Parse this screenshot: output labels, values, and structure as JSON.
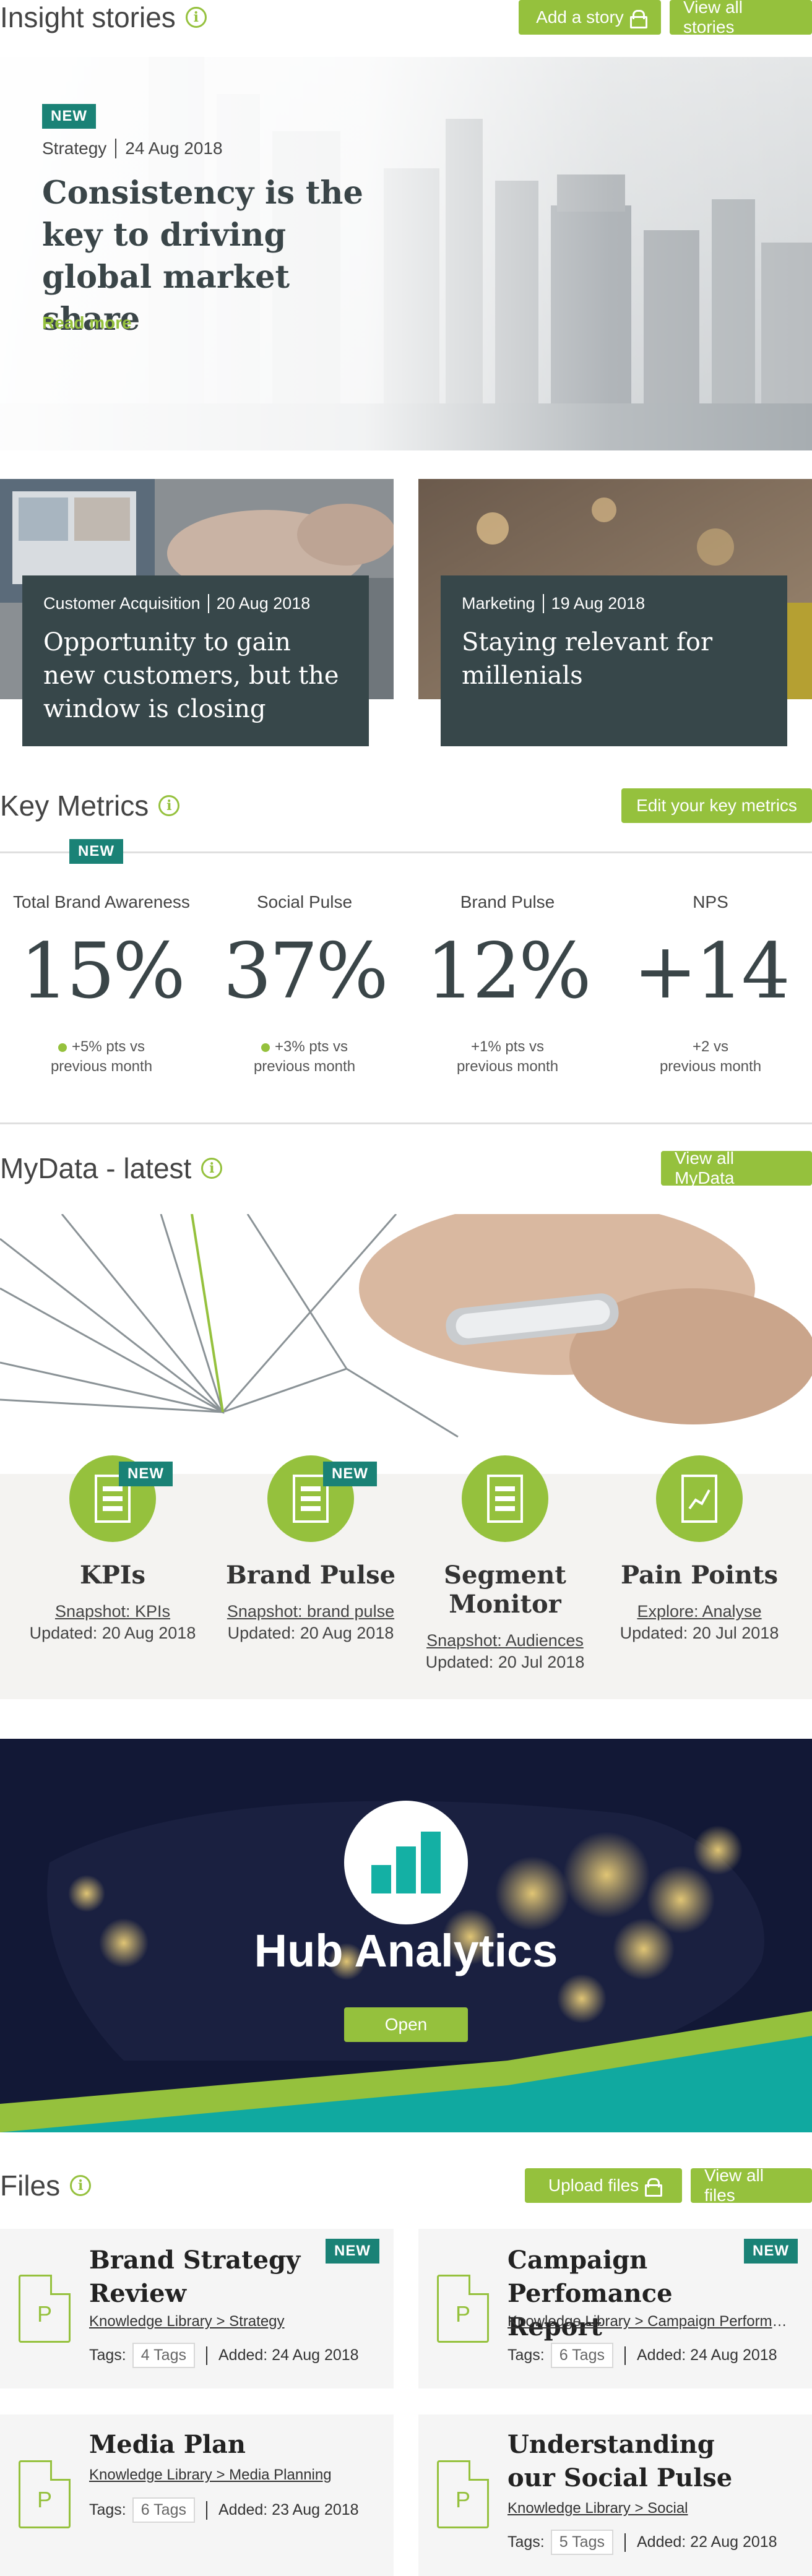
{
  "insight": {
    "title": "Insight stories",
    "add_story_label": "Add a story",
    "view_all_label": "View all stories",
    "hero": {
      "badge": "NEW",
      "category": "Strategy",
      "date": "24 Aug 2018",
      "headline": "Consistency is the key to driving global market share",
      "read_more": "Read more"
    },
    "cards": [
      {
        "category": "Customer Acquisition",
        "date": "20 Aug 2018",
        "headline": "Opportunity to gain new customers, but the window is closing"
      },
      {
        "category": "Marketing",
        "date": "19 Aug 2018",
        "headline": "Staying relevant for millenials"
      }
    ]
  },
  "metrics": {
    "title": "Key Metrics",
    "edit_label": "Edit your key metrics",
    "badge": "NEW",
    "items": [
      {
        "label": "Total Brand Awareness",
        "value": "15%",
        "delta_line1": "+5% pts vs",
        "delta_line2": "previous month"
      },
      {
        "label": "Social Pulse",
        "value": "37%",
        "delta_line1": "+3% pts vs",
        "delta_line2": "previous month"
      },
      {
        "label": "Brand Pulse",
        "value": "12%",
        "delta_line1": "+1% pts vs",
        "delta_line2": "previous month"
      },
      {
        "label": "NPS",
        "value": "+14",
        "delta_line1": "+2 vs",
        "delta_line2": "previous month"
      }
    ]
  },
  "mydata": {
    "title": "MyData - latest",
    "view_all_label": "View all MyData",
    "badge": "NEW",
    "tiles": [
      {
        "name": "KPIs",
        "link": "Snapshot: KPIs",
        "updated": "Updated: 20 Aug 2018"
      },
      {
        "name": "Brand Pulse",
        "link": "Snapshot: brand pulse",
        "updated": "Updated: 20 Aug 2018"
      },
      {
        "name": "Segment Monitor",
        "link": "Snapshot: Audiences",
        "updated": "Updated: 20 Jul 2018"
      },
      {
        "name": "Pain Points",
        "link": "Explore: Analyse",
        "updated": "Updated: 20 Jul 2018"
      }
    ]
  },
  "hub": {
    "title": "Hub Analytics",
    "open_label": "Open"
  },
  "files": {
    "title": "Files",
    "upload_label": "Upload files",
    "view_all_label": "View all files",
    "badge": "NEW",
    "tags_label": "Tags:",
    "items": [
      {
        "title": "Brand Strategy Review",
        "path": "Knowledge Library > Strategy",
        "tags": "4 Tags",
        "added": "Added: 24 Aug 2018",
        "icon_letter": "P"
      },
      {
        "title": "Campaign Perfomance Report",
        "path": "Knowledge Library > Campaign Performance",
        "tags": "6 Tags",
        "added": "Added: 24 Aug 2018",
        "icon_letter": "P"
      },
      {
        "title": "Media Plan",
        "path": "Knowledge Library > Media Planning",
        "tags": "6 Tags",
        "added": "Added: 23 Aug 2018",
        "icon_letter": "P"
      },
      {
        "title": "Understanding our Social Pulse",
        "path": "Knowledge Library > Social",
        "tags": "5 Tags",
        "added": "Added: 22 Aug 2018",
        "icon_letter": "P"
      }
    ]
  },
  "colors": {
    "accent": "#95c13d",
    "teal": "#1a8276",
    "dark_card": "#37474a"
  }
}
